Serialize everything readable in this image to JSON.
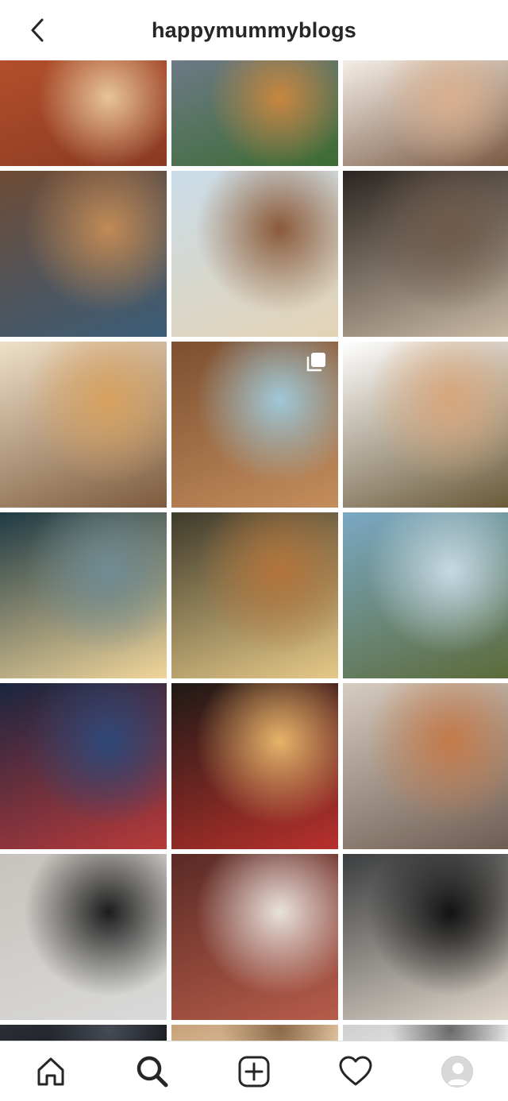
{
  "header": {
    "back_icon": "chevron-left-icon",
    "username": "happymummyblogs"
  },
  "grid": {
    "posts": [
      {
        "name": "breakfast-bacon",
        "colors": [
          "#b24f2c",
          "#e7c59a",
          "#8a3a22"
        ],
        "multi": false
      },
      {
        "name": "toasted-sandwich",
        "colors": [
          "#6c7a86",
          "#c8863f",
          "#3c6b32"
        ],
        "multi": false
      },
      {
        "name": "girl-smiling",
        "colors": [
          "#f4eee7",
          "#d9b08f",
          "#7a5a44"
        ],
        "multi": false
      },
      {
        "name": "boat-harbour-puzzle",
        "colors": [
          "#6e4b35",
          "#c18a56",
          "#3b5d78"
        ],
        "multi": false
      },
      {
        "name": "giraffe",
        "colors": [
          "#c9dce8",
          "#8a5a3a",
          "#e3d3b6"
        ],
        "multi": false
      },
      {
        "name": "family-theatre-stage",
        "colors": [
          "#2a2522",
          "#6f5a4a",
          "#c8b9a3"
        ],
        "multi": false
      },
      {
        "name": "toddler-sweater",
        "colors": [
          "#efe0c9",
          "#d7a15f",
          "#7c5b3e"
        ],
        "multi": false
      },
      {
        "name": "pancakes-table",
        "colors": [
          "#7c4f30",
          "#9fc8d8",
          "#c48d5c"
        ],
        "multi": true
      },
      {
        "name": "toddler-field-vignette",
        "colors": [
          "#ffffff",
          "#d7a67b",
          "#6a5a3a"
        ],
        "multi": false
      },
      {
        "name": "moody-sunset-sky",
        "colors": [
          "#1e3a44",
          "#6f8b92",
          "#f1d59a"
        ],
        "multi": false
      },
      {
        "name": "tree-sunlight",
        "colors": [
          "#3e3b2b",
          "#b3743c",
          "#e6c988"
        ],
        "multi": false
      },
      {
        "name": "church-graveyard",
        "colors": [
          "#7aa8c4",
          "#c6d9e3",
          "#5c6b3a"
        ],
        "multi": false
      },
      {
        "name": "kids-window-moon",
        "colors": [
          "#1a2540",
          "#2e4878",
          "#b83a3a"
        ],
        "multi": false
      },
      {
        "name": "snowman-lights",
        "colors": [
          "#1e1a16",
          "#e6b46a",
          "#b8302c"
        ],
        "multi": false
      },
      {
        "name": "playroom-table",
        "colors": [
          "#d6ccbf",
          "#c37a4a",
          "#6e5d52"
        ],
        "multi": false
      },
      {
        "name": "remember-painted-stone",
        "colors": [
          "#c7c3bc",
          "#1c1c1c",
          "#d9d9d9"
        ],
        "multi": false
      },
      {
        "name": "afternoon-tea",
        "colors": [
          "#5a2a25",
          "#e9e2dc",
          "#b75c4a"
        ],
        "multi": false
      },
      {
        "name": "skeleton-costume",
        "colors": [
          "#3b3d3f",
          "#121212",
          "#e0d7cc"
        ],
        "multi": false
      },
      {
        "name": "partial-1",
        "colors": [
          "#2a2e36",
          "#454b55",
          "#1a1c20"
        ],
        "multi": false
      },
      {
        "name": "partial-2",
        "colors": [
          "#c7a27a",
          "#8c6a4a",
          "#e0c49f"
        ],
        "multi": false
      },
      {
        "name": "partial-3",
        "colors": [
          "#cfcfcf",
          "#6a6a6a",
          "#e8e8e8"
        ],
        "multi": false
      }
    ]
  },
  "bottom_nav": {
    "items": [
      {
        "icon": "home-icon",
        "active": false
      },
      {
        "icon": "search-icon",
        "active": true
      },
      {
        "icon": "plus-square-icon",
        "active": false
      },
      {
        "icon": "heart-icon",
        "active": false
      },
      {
        "icon": "profile-avatar-icon",
        "active": false
      }
    ]
  },
  "colors": {
    "text_primary": "#262626",
    "border": "#dbdbdb",
    "background": "#ffffff"
  }
}
